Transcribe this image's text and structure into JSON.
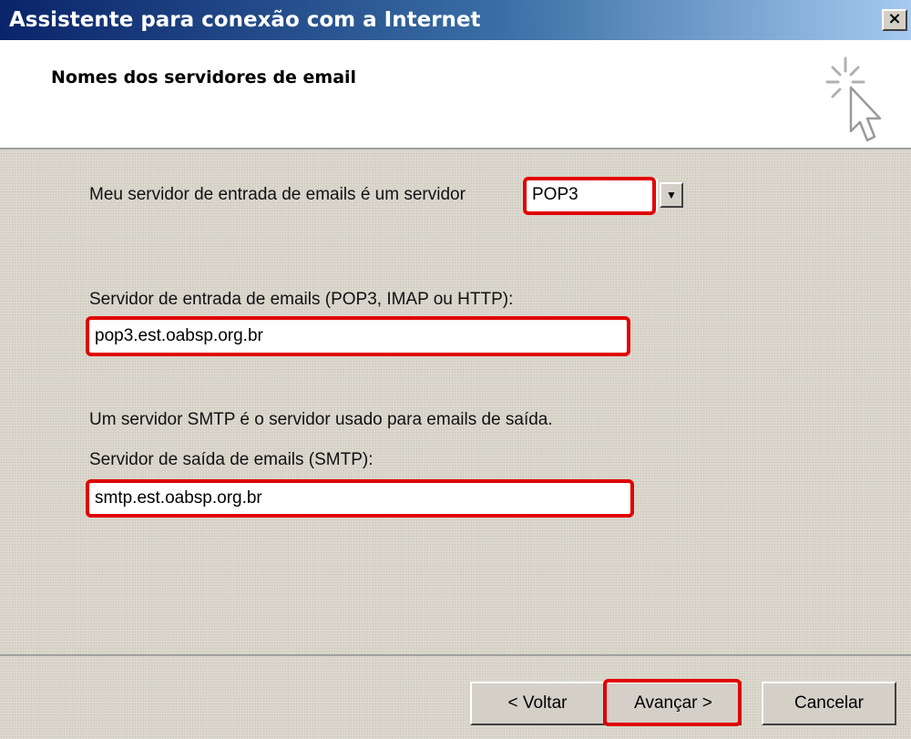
{
  "window": {
    "title": "Assistente para conexão com a Internet",
    "close_label": "×"
  },
  "header": {
    "title": "Nomes dos servidores de email"
  },
  "form": {
    "incoming_type_label": "Meu servidor de entrada de emails é um  servidor",
    "incoming_type_value": "POP3",
    "incoming_server_label": "Servidor de entrada de emails (POP3, IMAP ou HTTP):",
    "incoming_server_value": "pop3.est.oabsp.org.br",
    "smtp_info": "Um servidor SMTP é o servidor usado para emails de saída.",
    "outgoing_server_label": "Servidor de saída de emails (SMTP):",
    "outgoing_server_value": "smtp.est.oabsp.org.br"
  },
  "buttons": {
    "back": "< Voltar",
    "next": "Avançar >",
    "cancel": "Cancelar"
  },
  "colors": {
    "highlight": "#e00000",
    "titlebar_start": "#0a246a",
    "titlebar_end": "#a6caf0"
  },
  "icons": {
    "wizard": "cursor-sparkle-icon",
    "dropdown": "chevron-down-icon"
  }
}
